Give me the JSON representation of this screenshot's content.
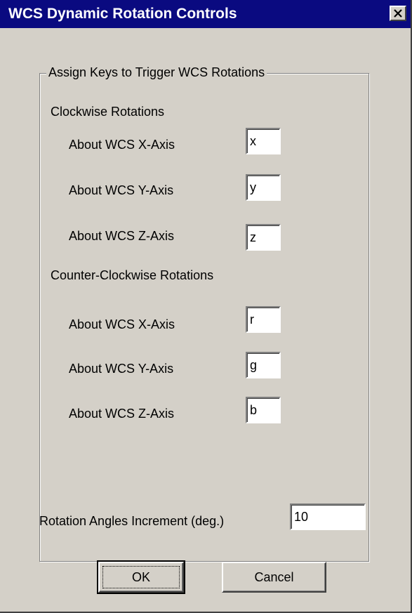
{
  "window": {
    "title": "WCS Dynamic Rotation Controls",
    "close_icon": "close-icon"
  },
  "group": {
    "legend": "Assign Keys to Trigger WCS Rotations",
    "clockwise": {
      "heading": "Clockwise Rotations",
      "rows": [
        {
          "label": "About WCS X-Axis",
          "value": "x"
        },
        {
          "label": "About WCS Y-Axis",
          "value": "y"
        },
        {
          "label": "About WCS Z-Axis",
          "value": "z"
        }
      ]
    },
    "counter_clockwise": {
      "heading": "Counter-Clockwise Rotations",
      "rows": [
        {
          "label": "About WCS X-Axis",
          "value": "r"
        },
        {
          "label": "About WCS Y-Axis",
          "value": "g"
        },
        {
          "label": "About WCS Z-Axis",
          "value": "b"
        }
      ]
    }
  },
  "increment": {
    "label": "Rotation Angles Increment (deg.)",
    "value": "10"
  },
  "buttons": {
    "ok_label": "OK",
    "cancel_label": "Cancel"
  },
  "colors": {
    "titlebar": "#0a0a80",
    "dialog_face": "#d4d0c8",
    "field_bg": "#ffffff"
  }
}
